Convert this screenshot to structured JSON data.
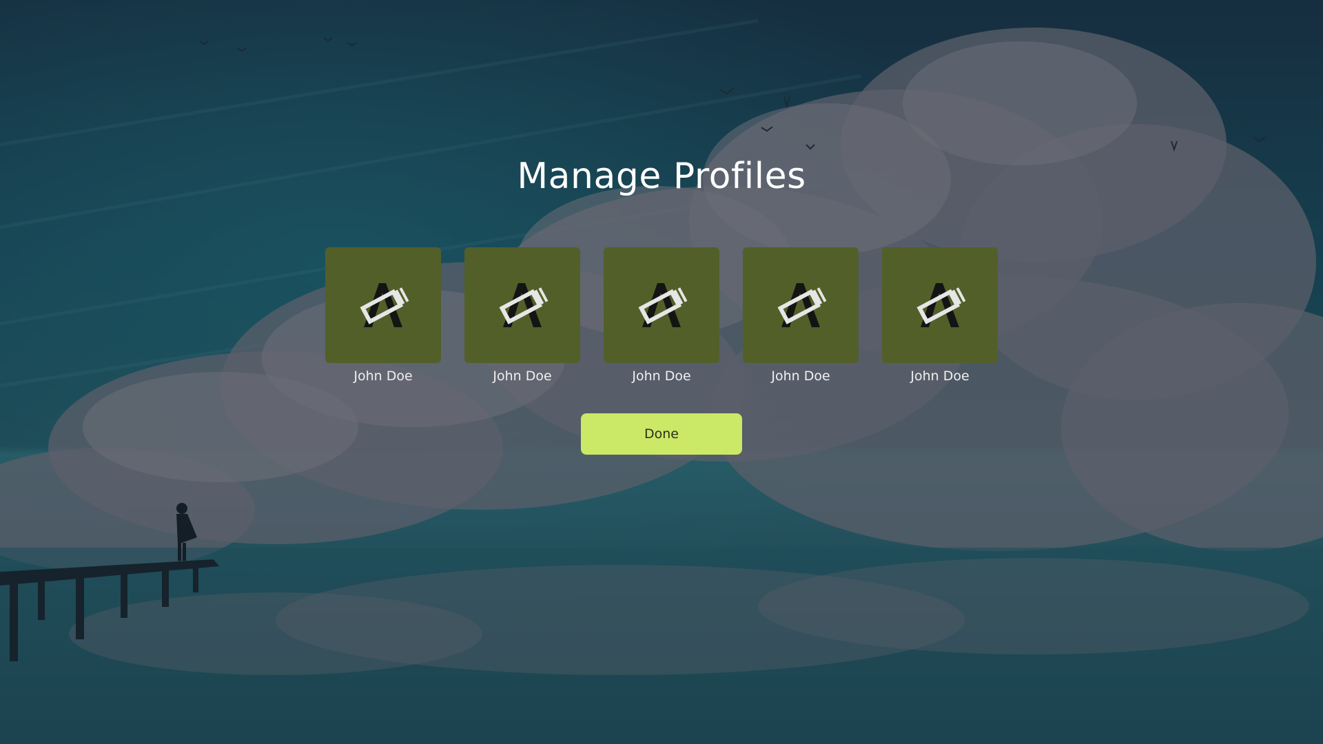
{
  "page": {
    "title": "Manage Profiles"
  },
  "profiles": [
    {
      "name": "John Doe",
      "avatar_icon": "pencil-edit-icon"
    },
    {
      "name": "John Doe",
      "avatar_icon": "pencil-edit-icon"
    },
    {
      "name": "John Doe",
      "avatar_icon": "pencil-edit-icon"
    },
    {
      "name": "John Doe",
      "avatar_icon": "pencil-edit-icon"
    },
    {
      "name": "John Doe",
      "avatar_icon": "pencil-edit-icon"
    }
  ],
  "actions": {
    "done_label": "Done"
  },
  "colors": {
    "tile": "#525f29",
    "done_button": "#cbe866",
    "title_text": "#ffffff"
  }
}
